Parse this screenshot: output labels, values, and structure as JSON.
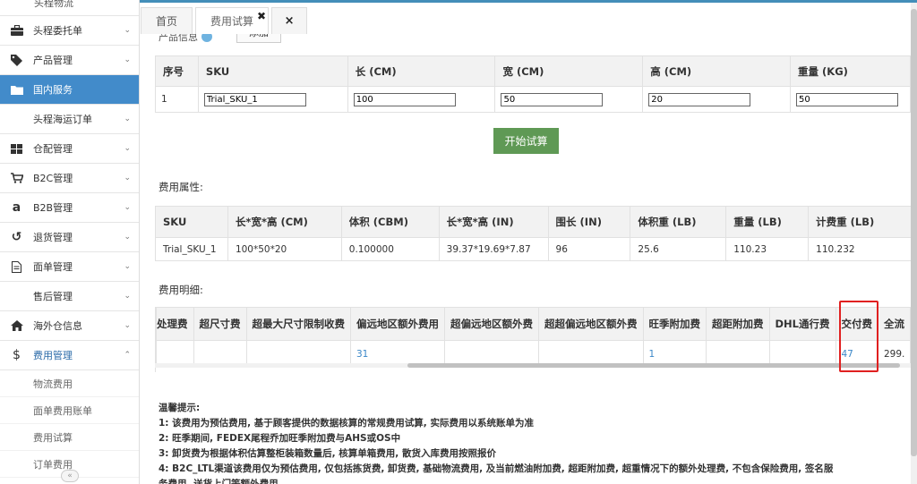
{
  "sidebar": {
    "top_cut_label": "头程物流",
    "items": [
      {
        "label": "头程委托单",
        "icon": "briefcase-icon"
      },
      {
        "label": "产品管理",
        "icon": "tag-icon"
      },
      {
        "label": "国内服务",
        "icon": "folder-icon",
        "active": true
      },
      {
        "label": "头程海运订单",
        "icon": ""
      },
      {
        "label": "仓配管理",
        "icon": "grid-icon"
      },
      {
        "label": "B2C管理",
        "icon": "cart-icon"
      },
      {
        "label": "B2B管理",
        "icon": "amazon-icon"
      },
      {
        "label": "退货管理",
        "icon": "undo-icon"
      },
      {
        "label": "面单管理",
        "icon": "document-icon"
      },
      {
        "label": "售后管理",
        "icon": ""
      },
      {
        "label": "海外仓信息",
        "icon": "home-icon"
      },
      {
        "label": "费用管理",
        "icon": "dollar-icon",
        "expanded": true
      }
    ],
    "children": [
      "物流费用",
      "面单费用账单",
      "费用试算",
      "订单费用"
    ],
    "collapse_glyph": "«"
  },
  "tabs": {
    "home": "首页",
    "active": "费用试算",
    "close_all": "×"
  },
  "cut_row": {
    "label": "产品信息",
    "add_button": "添加"
  },
  "input_table": {
    "headers": [
      "序号",
      "SKU",
      "长 (CM)",
      "宽 (CM)",
      "高 (CM)",
      "重量 (KG)"
    ],
    "row": {
      "index": "1",
      "sku": "Trial_SKU_1",
      "length": "100",
      "width": "50",
      "height": "20",
      "weight": "50"
    }
  },
  "start_button": "开始试算",
  "attr_section": {
    "label": "费用属性:",
    "headers": [
      "SKU",
      "长*宽*高 (CM)",
      "体积 (CBM)",
      "长*宽*高 (IN)",
      "围长 (IN)",
      "体积重 (LB)",
      "重量 (LB)",
      "计费重 (LB)"
    ],
    "row": [
      "Trial_SKU_1",
      "100*50*20",
      "0.100000",
      "39.37*19.69*7.87",
      "96",
      "25.6",
      "110.23",
      "110.232"
    ]
  },
  "detail_section": {
    "label": "费用明细:",
    "headers": [
      "处理费",
      "超尺寸费",
      "超最大尺寸限制收费",
      "偏远地区额外费用",
      "超偏远地区额外费",
      "超超偏远地区额外费",
      "旺季附加费",
      "超距附加费",
      "DHL通行费",
      "交付费",
      "全流"
    ],
    "row": [
      "",
      "",
      "",
      "31",
      "",
      "",
      "1",
      "",
      "",
      "47",
      "299."
    ]
  },
  "notes": {
    "title": "温馨提示:",
    "lines": [
      "1: 该费用为预估费用, 基于顾客提供的数据核算的常规费用试算, 实际费用以系统账单为准",
      "2: 旺季期间, FEDEX尾程乔加旺季附加费与AHS或OS中",
      "3: 卸货费为根据体积估算整柜装箱数量后, 核算单箱费用, 散货入库费用按照报价",
      "4: B2C_LTL渠道该费用仅为预估费用, 仅包括拣货费, 卸货费, 基础物流费用, 及当前燃油附加费, 超距附加费, 超重情况下的额外处理费, 不包含保险费用, 签名服",
      "务费用, 送货上门等额外费用"
    ]
  },
  "colors": {
    "accent": "#428bca",
    "start_button": "#5f9955",
    "link": "#3a87c8",
    "highlight": "#e02020"
  }
}
